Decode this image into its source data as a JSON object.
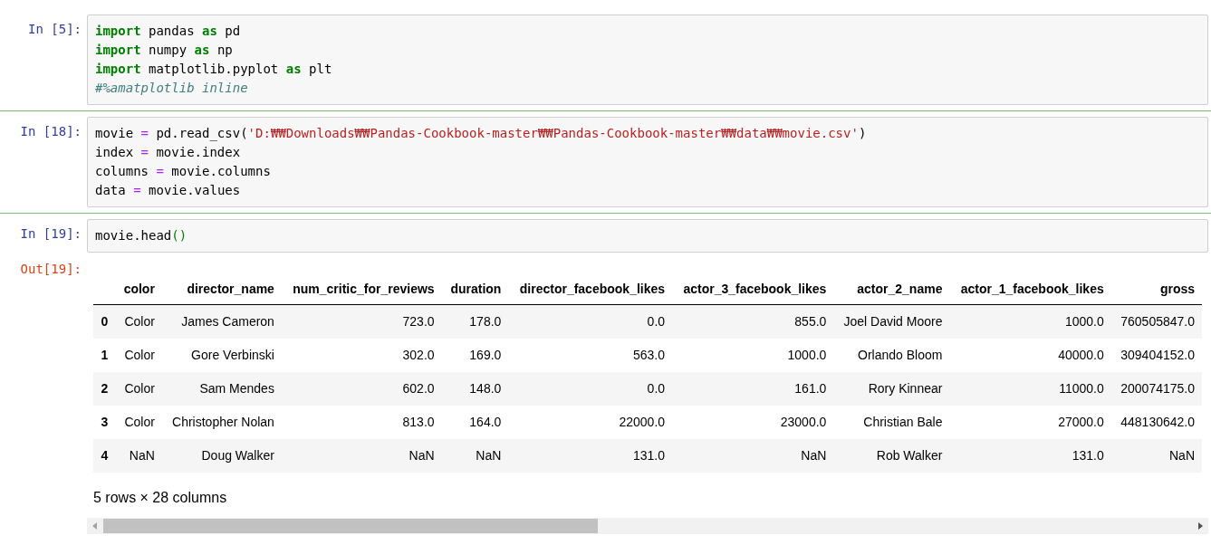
{
  "cells": [
    {
      "prompt": "In [5]:",
      "lines": [
        [
          {
            "kind": "keyword",
            "text": "import"
          },
          {
            "kind": "name",
            "text": " pandas "
          },
          {
            "kind": "keyword",
            "text": "as"
          },
          {
            "kind": "name",
            "text": " pd"
          }
        ],
        [
          {
            "kind": "keyword",
            "text": "import"
          },
          {
            "kind": "name",
            "text": " numpy "
          },
          {
            "kind": "keyword",
            "text": "as"
          },
          {
            "kind": "name",
            "text": " np"
          }
        ],
        [
          {
            "kind": "keyword",
            "text": "import"
          },
          {
            "kind": "name",
            "text": " matplotlib.pyplot "
          },
          {
            "kind": "keyword",
            "text": "as"
          },
          {
            "kind": "name",
            "text": " plt"
          }
        ],
        [
          {
            "kind": "comment",
            "text": "#%amatplotlib inline"
          }
        ]
      ]
    },
    {
      "prompt": "In [18]:",
      "lines": [
        [
          {
            "kind": "name",
            "text": "movie "
          },
          {
            "kind": "operator",
            "text": "="
          },
          {
            "kind": "name",
            "text": " pd.read_csv("
          },
          {
            "kind": "string",
            "text": "'D:₩₩Downloads₩₩Pandas-Cookbook-master₩₩Pandas-Cookbook-master₩₩data₩₩movie.csv'"
          },
          {
            "kind": "name",
            "text": ")"
          }
        ],
        [
          {
            "kind": "name",
            "text": "index "
          },
          {
            "kind": "operator",
            "text": "="
          },
          {
            "kind": "name",
            "text": " movie.index"
          }
        ],
        [
          {
            "kind": "name",
            "text": "columns "
          },
          {
            "kind": "operator",
            "text": "="
          },
          {
            "kind": "name",
            "text": " movie.columns"
          }
        ],
        [
          {
            "kind": "name",
            "text": "data "
          },
          {
            "kind": "operator",
            "text": "="
          },
          {
            "kind": "name",
            "text": " movie.values"
          }
        ]
      ]
    },
    {
      "prompt": "In [19]:",
      "lines": [
        [
          {
            "kind": "name",
            "text": "movie.head"
          },
          {
            "kind": "bracket",
            "text": "()"
          }
        ]
      ],
      "output": {
        "prompt": "Out[19]:",
        "table": {
          "columns": [
            "color",
            "director_name",
            "num_critic_for_reviews",
            "duration",
            "director_facebook_likes",
            "actor_3_facebook_likes",
            "actor_2_name",
            "actor_1_facebook_likes",
            "gross"
          ],
          "rows": [
            {
              "index": "0",
              "cells": [
                "Color",
                "James Cameron",
                "723.0",
                "178.0",
                "0.0",
                "855.0",
                "Joel David Moore",
                "1000.0",
                "760505847.0"
              ]
            },
            {
              "index": "1",
              "cells": [
                "Color",
                "Gore Verbinski",
                "302.0",
                "169.0",
                "563.0",
                "1000.0",
                "Orlando Bloom",
                "40000.0",
                "309404152.0"
              ]
            },
            {
              "index": "2",
              "cells": [
                "Color",
                "Sam Mendes",
                "602.0",
                "148.0",
                "0.0",
                "161.0",
                "Rory Kinnear",
                "11000.0",
                "200074175.0"
              ]
            },
            {
              "index": "3",
              "cells": [
                "Color",
                "Christopher Nolan",
                "813.0",
                "164.0",
                "22000.0",
                "23000.0",
                "Christian Bale",
                "27000.0",
                "448130642.0"
              ]
            },
            {
              "index": "4",
              "cells": [
                "NaN",
                "Doug Walker",
                "NaN",
                "NaN",
                "131.0",
                "NaN",
                "Rob Walker",
                "131.0",
                "NaN"
              ]
            }
          ]
        },
        "summary": "5 rows × 28 columns"
      }
    }
  ]
}
